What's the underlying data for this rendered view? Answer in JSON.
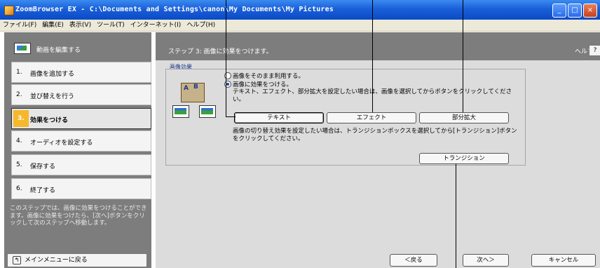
{
  "window": {
    "title": "ZoomBrowser EX  -  C:\\Documents and Settings\\canon\\My Documents\\My Pictures",
    "controls": [
      "_",
      "□",
      "×"
    ]
  },
  "menu": [
    "ファイル(F)",
    "編集(E)",
    "表示(V)",
    "ツール(T)",
    "インターネット(I)",
    "ヘルプ(H)"
  ],
  "sidebar": {
    "header": "動画を編集する",
    "steps": [
      {
        "num": "1.",
        "label": "画像を追加する",
        "active": false
      },
      {
        "num": "2.",
        "label": "並び替えを行う",
        "active": false
      },
      {
        "num": "3.",
        "label": "効果をつける",
        "active": true
      },
      {
        "num": "4.",
        "label": "オーディオを設定する",
        "active": false
      },
      {
        "num": "5.",
        "label": "保存する",
        "active": false
      },
      {
        "num": "6.",
        "label": "終了する",
        "active": false
      }
    ],
    "description": "このステップでは、画像に効果をつけることができます。画像に効果をつけたら、[次へ]ボタンをクリックして次のステップへ移動します。",
    "back_button": "メインメニューに戻る"
  },
  "main": {
    "step_title": "ステップ 3: 画像に効果をつけます。",
    "help_label": "ヘルプ",
    "help_button": "?",
    "section_title": "画像効果",
    "radio_use_as_is": "画像をそのまま利用する。",
    "radio_apply_effect": "画像に効果をつける。",
    "effect_hint": "テキスト、エフェクト、部分拡大を設定したい場合は、画像を選択してからボタンをクリックしてください。",
    "text_button": "テキスト",
    "effect_button": "エフェクト",
    "zoom_button": "部分拡大",
    "transition_hint": "画像の切り替え効果を設定したい場合は、トランジションボックスを選択してから[トランジション]ボタンをクリックしてください。",
    "transition_button": "トランジション"
  },
  "footer": {
    "back": "＜戻る",
    "next": "次へ＞",
    "cancel": "キャンセル"
  }
}
